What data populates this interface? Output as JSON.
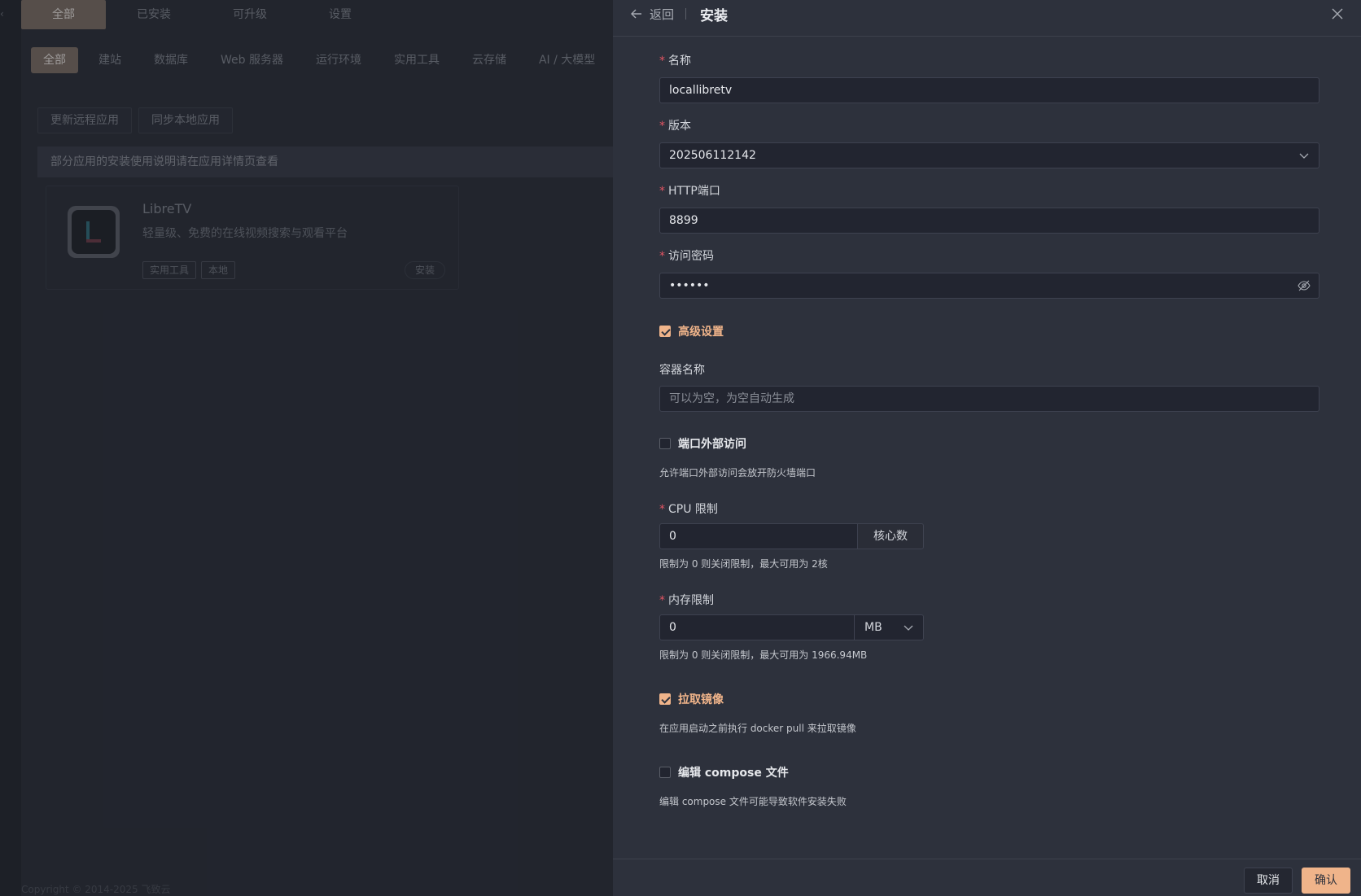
{
  "background": {
    "top_tabs": [
      "全部",
      "已安装",
      "可升级",
      "设置"
    ],
    "categories": [
      "全部",
      "建站",
      "数据库",
      "Web 服务器",
      "运行环境",
      "实用工具",
      "云存储",
      "AI / 大模型"
    ],
    "actions": [
      "更新远程应用",
      "同步本地应用"
    ],
    "notice": "部分应用的安装使用说明请在应用详情页查看",
    "card": {
      "title": "LibreTV",
      "description": "轻量级、免费的在线视频搜索与观看平台",
      "tags": [
        "实用工具",
        "本地"
      ],
      "install_label": "安装"
    },
    "footer": "Copyright © 2014-2025 飞致云"
  },
  "drawer": {
    "back_label": "返回",
    "title": "安装",
    "fields": {
      "name": {
        "label": "名称",
        "value": "locallibretv"
      },
      "version": {
        "label": "版本",
        "value": "202506112142"
      },
      "http_port": {
        "label": "HTTP端口",
        "value": "8899"
      },
      "password": {
        "label": "访问密码",
        "value": "••••••"
      },
      "advanced": {
        "label": "高级设置",
        "checked": true
      },
      "container_name": {
        "label": "容器名称",
        "placeholder": "可以为空，为空自动生成"
      },
      "external_access": {
        "label": "端口外部访问",
        "checked": false,
        "help": "允许端口外部访问会放开防火墙端口"
      },
      "cpu_limit": {
        "label": "CPU 限制",
        "value": "0",
        "unit": "核心数",
        "help": "限制为 0 则关闭限制，最大可用为 2核"
      },
      "memory_limit": {
        "label": "内存限制",
        "value": "0",
        "unit": "MB",
        "help": "限制为 0 则关闭限制，最大可用为 1966.94MB"
      },
      "pull_image": {
        "label": "拉取镜像",
        "checked": true,
        "help": "在应用启动之前执行 docker pull 来拉取镜像"
      },
      "edit_compose": {
        "label": "编辑 compose 文件",
        "checked": false,
        "help": "编辑 compose 文件可能导致软件安装失败"
      }
    },
    "footer": {
      "cancel_label": "取消",
      "confirm_label": "确认"
    }
  },
  "colors": {
    "accent": "#f0b48a",
    "required": "#e25563",
    "drawer_bg": "#2d313c"
  },
  "icons": [
    "arrow-left-icon",
    "close-icon",
    "chevron-down-icon",
    "eye-off-icon",
    "check-icon"
  ]
}
